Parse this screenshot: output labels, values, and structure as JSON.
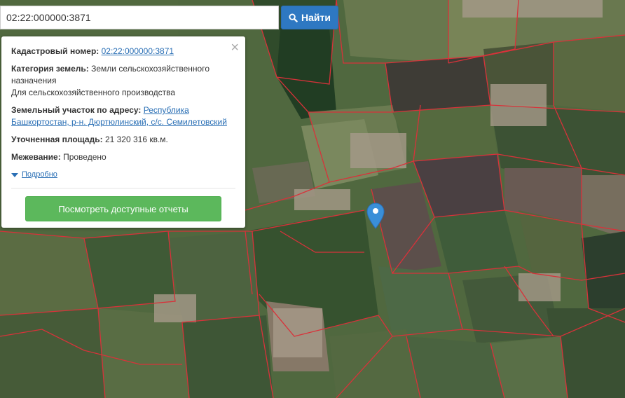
{
  "search": {
    "value": "02:22:000000:3871",
    "button_label": "Найти"
  },
  "info": {
    "cadastral_label": "Кадастровый номер:",
    "cadastral_value": "02:22:000000:3871",
    "category_label": "Категория земель:",
    "category_value_line1": "Земли сельскохозяйственного",
    "category_value_line2": "назначения",
    "category_usage": "Для сельскохозяйственного производства",
    "address_label": "Земельный участок по адресу:",
    "address_value_line1": "Республика",
    "address_value_line2": "Башкортостан, р-н. Дюртюлинский, с/с. Семилетовский",
    "area_label": "Уточненная площадь:",
    "area_value": "21 320 316 кв.м.",
    "survey_label": "Межевание:",
    "survey_value": "Проведено",
    "more_label": "Подробно",
    "reports_button": "Посмотреть доступные отчеты",
    "close_symbol": "×"
  },
  "colors": {
    "parcel_border": "#d8323a",
    "search_button": "#2e78c2",
    "reports_button": "#5cb85c",
    "pin": "#3a8fd8"
  }
}
